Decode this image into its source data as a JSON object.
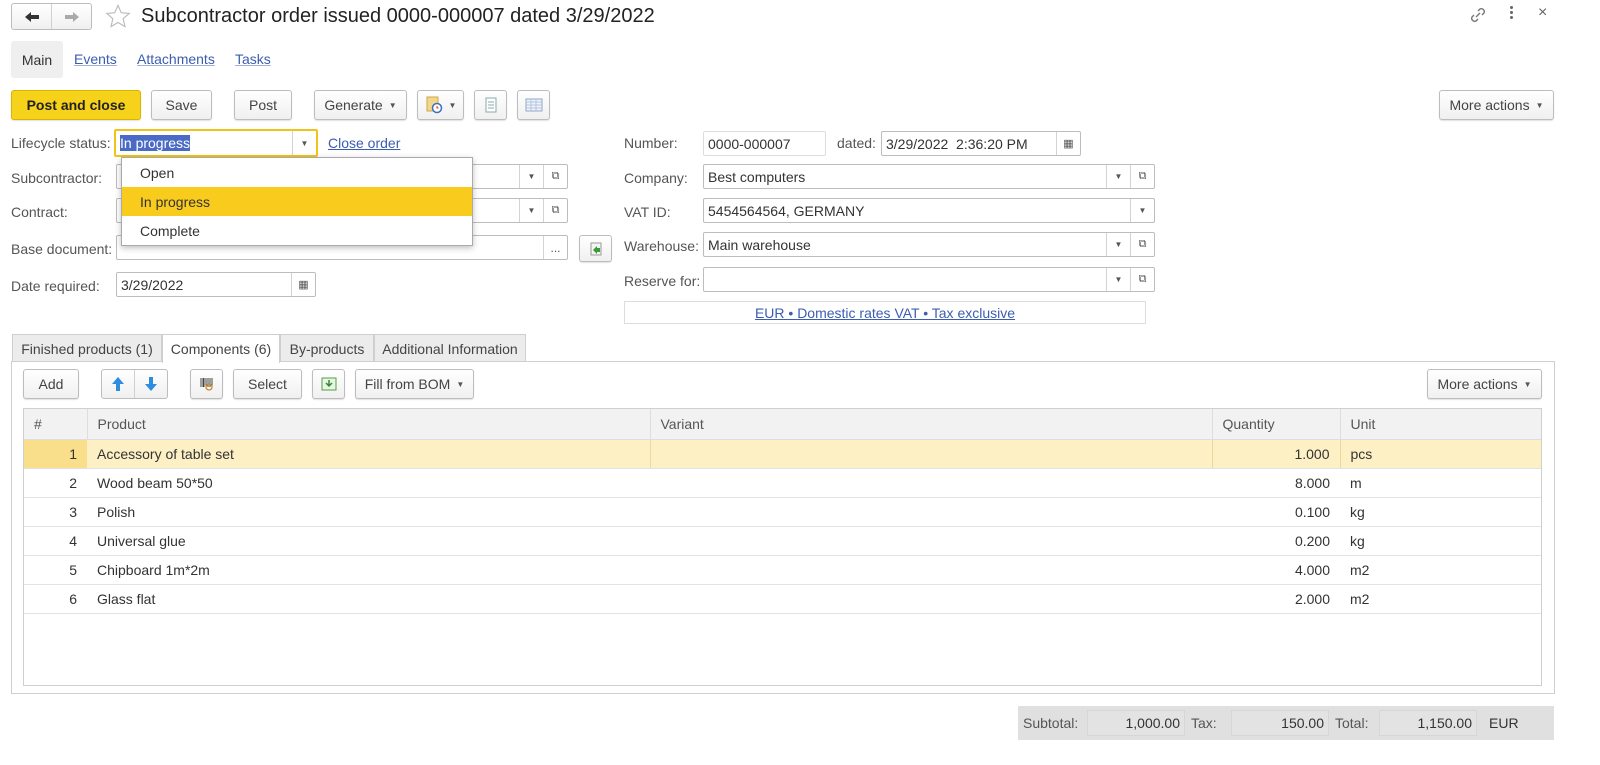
{
  "header": {
    "title": "Subcontractor order issued 0000-000007 dated 3/29/2022",
    "back_icon": "arrow-left-icon",
    "forward_icon": "arrow-right-icon",
    "favorite_icon": "star-icon",
    "link_icon": "link-icon",
    "menu_icon": "kebab-menu-icon",
    "close_icon": "close-icon"
  },
  "nav_tabs": [
    {
      "label": "Main",
      "active": true
    },
    {
      "label": "Events"
    },
    {
      "label": "Attachments"
    },
    {
      "label": "Tasks"
    }
  ],
  "toolbar": {
    "post_and_close": "Post and close",
    "save": "Save",
    "post": "Post",
    "generate": "Generate",
    "more_actions": "More actions"
  },
  "form": {
    "lifecycle_status": {
      "label": "Lifecycle status:",
      "value": "In progress"
    },
    "close_order": "Close order",
    "subcontractor": {
      "label": "Subcontractor:",
      "value": ""
    },
    "contract": {
      "label": "Contract:",
      "value": ""
    },
    "base_document": {
      "label": "Base document:",
      "value": ""
    },
    "date_required": {
      "label": "Date required:",
      "value": "3/29/2022"
    },
    "number": {
      "label": "Number:",
      "value": "0000-000007"
    },
    "dated": {
      "label": "dated:",
      "value": "3/29/2022  2:36:20 PM"
    },
    "company": {
      "label": "Company:",
      "value": "Best computers"
    },
    "vat_id": {
      "label": "VAT ID:",
      "value": "5454564564, GERMANY"
    },
    "warehouse": {
      "label": "Warehouse:",
      "value": "Main warehouse"
    },
    "reserve_for": {
      "label": "Reserve for:",
      "value": ""
    },
    "currency_link": "EUR • Domestic rates VAT • Tax exclusive"
  },
  "status_dropdown": {
    "options": [
      "Open",
      "In progress",
      "Complete"
    ],
    "highlighted": "In progress"
  },
  "page_tabs": [
    {
      "label": "Finished products (1)"
    },
    {
      "label": "Components (6)",
      "active": true
    },
    {
      "label": "By-products"
    },
    {
      "label": "Additional Information"
    }
  ],
  "table_toolbar": {
    "add": "Add",
    "select": "Select",
    "fill_from_bom": "Fill from BOM",
    "more_actions": "More actions"
  },
  "table": {
    "columns": [
      "#",
      "Product",
      "Variant",
      "Quantity",
      "Unit"
    ],
    "rows": [
      {
        "n": "1",
        "product": "Accessory of table set",
        "variant": "",
        "quantity": "1.000",
        "unit": "pcs",
        "selected": true
      },
      {
        "n": "2",
        "product": "Wood beam 50*50",
        "variant": "",
        "quantity": "8.000",
        "unit": "m"
      },
      {
        "n": "3",
        "product": "Polish",
        "variant": "",
        "quantity": "0.100",
        "unit": "kg"
      },
      {
        "n": "4",
        "product": "Universal glue",
        "variant": "",
        "quantity": "0.200",
        "unit": "kg"
      },
      {
        "n": "5",
        "product": "Chipboard 1m*2m",
        "variant": "",
        "quantity": "4.000",
        "unit": "m2"
      },
      {
        "n": "6",
        "product": "Glass flat",
        "variant": "",
        "quantity": "2.000",
        "unit": "m2"
      }
    ]
  },
  "totals": {
    "subtotal_label": "Subtotal:",
    "subtotal": "1,000.00",
    "tax_label": "Tax:",
    "tax": "150.00",
    "total_label": "Total:",
    "total": "1,150.00",
    "currency": "EUR"
  },
  "colors": {
    "accent": "#f6d21a",
    "link": "#3b5db0",
    "selected_row": "#fdf0c4",
    "dropdown_highlight": "#f8cb1c"
  }
}
